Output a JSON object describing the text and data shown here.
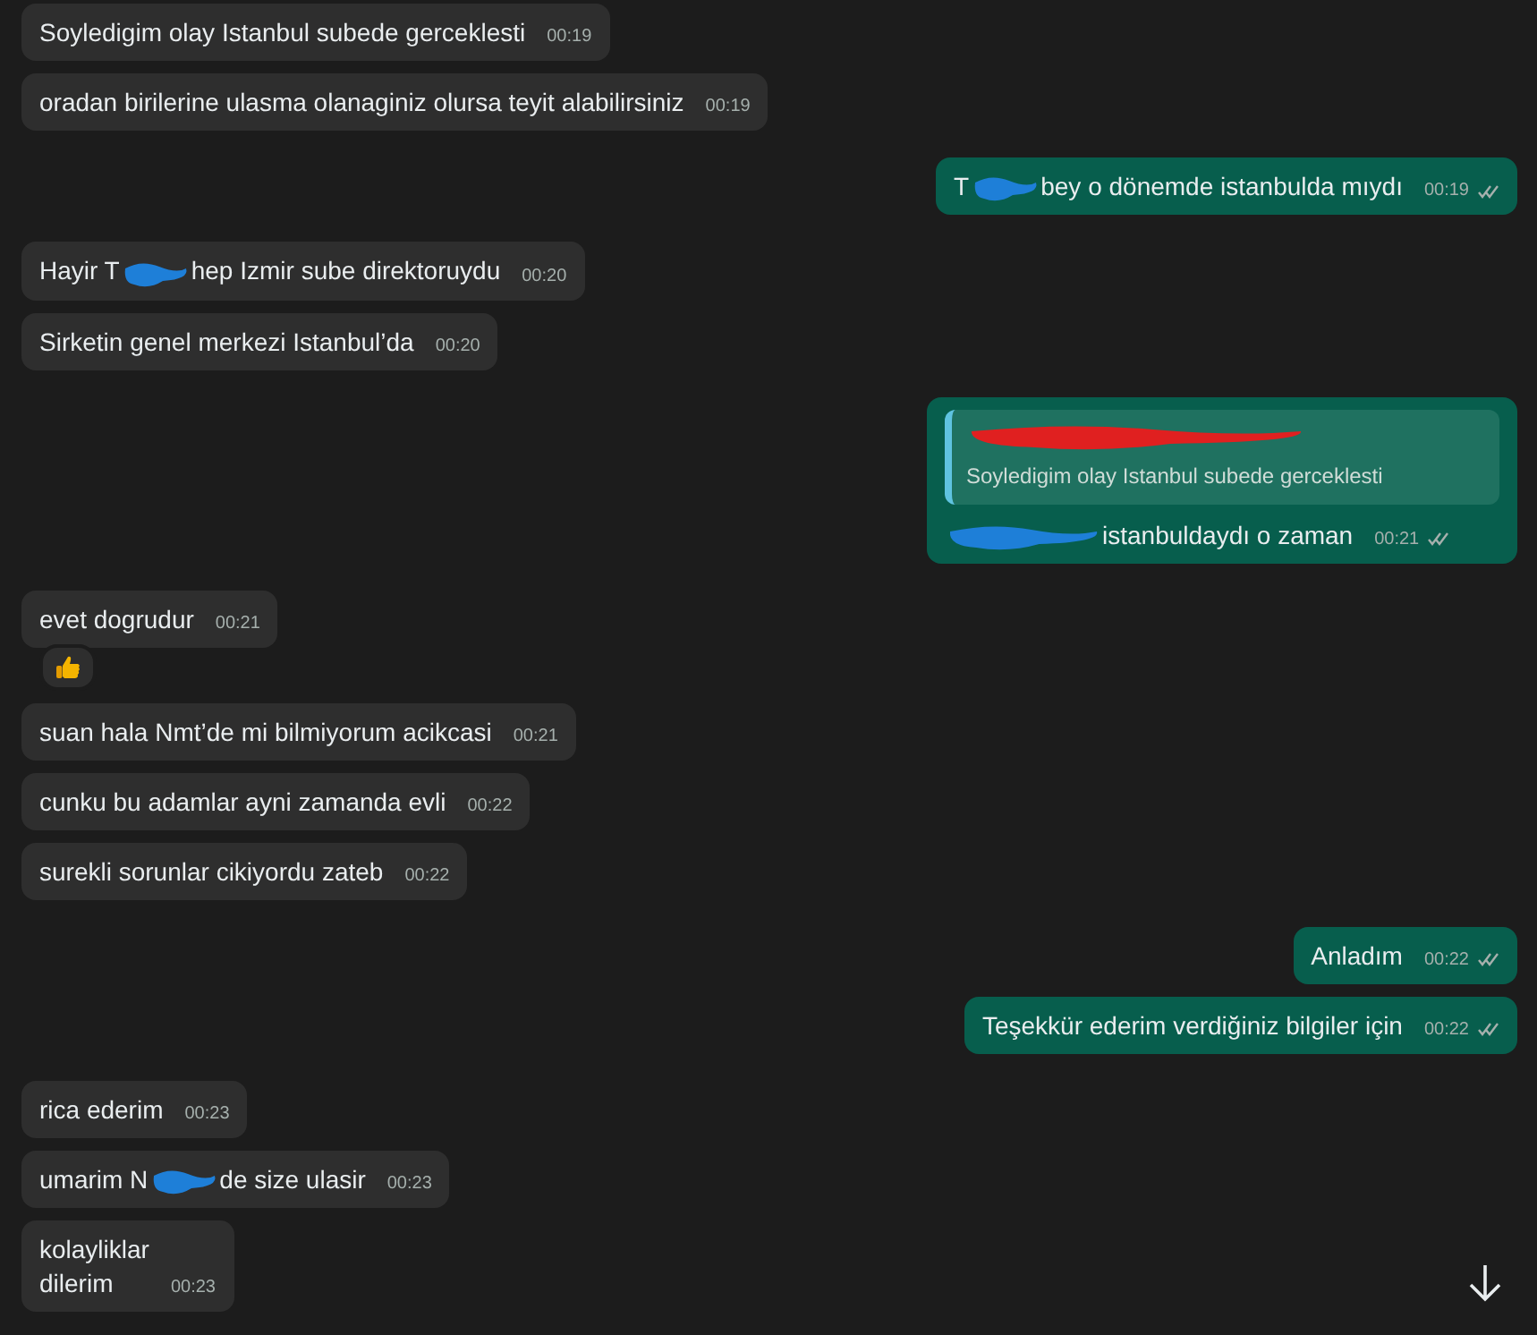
{
  "messages": [
    {
      "kind": "in",
      "parts": [
        {
          "kind": "text",
          "text": "Soyledigim olay Istanbul subede gerceklesti"
        }
      ],
      "time": "00:19"
    },
    {
      "kind": "in",
      "parts": [
        {
          "kind": "text",
          "text": "oradan birilerine ulasma olanaginiz olursa teyit alabilirsiniz"
        }
      ],
      "time": "00:19"
    },
    {
      "kind": "out",
      "parts": [
        {
          "kind": "text",
          "text": "T"
        },
        {
          "kind": "redaction",
          "color": "#1e7fd8"
        },
        {
          "kind": "text",
          "text": "bey o dönemde istanbulda mıydı"
        }
      ],
      "time": "00:19"
    },
    {
      "kind": "in",
      "parts": [
        {
          "kind": "text",
          "text": "Hayir T"
        },
        {
          "kind": "redaction",
          "color": "#1e7fd8"
        },
        {
          "kind": "text",
          "text": "hep Izmir sube direktoruydu"
        }
      ],
      "time": "00:20"
    },
    {
      "kind": "in",
      "parts": [
        {
          "kind": "text",
          "text": "Sirketin genel merkezi Istanbul’da"
        }
      ],
      "time": "00:20"
    },
    {
      "kind": "out",
      "quote": {
        "sender": {
          "kind": "redaction",
          "color": "#e02020"
        },
        "text": "Soyledigim olay Istanbul subede gerceklesti"
      },
      "parts": [
        {
          "kind": "redaction",
          "color": "#1e7fd8"
        },
        {
          "kind": "text",
          "text": "istanbuldaydı o zaman"
        }
      ],
      "time": "00:21"
    },
    {
      "kind": "in",
      "parts": [
        {
          "kind": "text",
          "text": "evet dogrudur"
        }
      ],
      "time": "00:21",
      "reaction": {
        "kind": "thumbs_up"
      }
    },
    {
      "kind": "in",
      "parts": [
        {
          "kind": "text",
          "text": "suan hala Nmt’de mi bilmiyorum acikcasi"
        }
      ],
      "time": "00:21"
    },
    {
      "kind": "in",
      "parts": [
        {
          "kind": "text",
          "text": "cunku bu adamlar ayni zamanda evli"
        }
      ],
      "time": "00:22"
    },
    {
      "kind": "in",
      "parts": [
        {
          "kind": "text",
          "text": "surekli sorunlar cikiyordu zateb"
        }
      ],
      "time": "00:22"
    },
    {
      "kind": "out",
      "parts": [
        {
          "kind": "text",
          "text": "Anladım"
        }
      ],
      "time": "00:22"
    },
    {
      "kind": "out",
      "parts": [
        {
          "kind": "text",
          "text": "Teşekkür ederim verdiğiniz bilgiler için"
        }
      ],
      "time": "00:22"
    },
    {
      "kind": "in",
      "parts": [
        {
          "kind": "text",
          "text": "rica ederim"
        }
      ],
      "time": "00:23"
    },
    {
      "kind": "in",
      "parts": [
        {
          "kind": "text",
          "text": "umarim N"
        },
        {
          "kind": "redaction",
          "color": "#1e7fd8"
        },
        {
          "kind": "text",
          "text": "de size ulasir"
        }
      ],
      "time": "00:23"
    },
    {
      "kind": "in",
      "parts": [
        {
          "kind": "text",
          "text": "kolayliklar\ndilerim"
        }
      ],
      "time": "00:23"
    }
  ],
  "scroll_down_button": {
    "kind": "arrow_down"
  }
}
